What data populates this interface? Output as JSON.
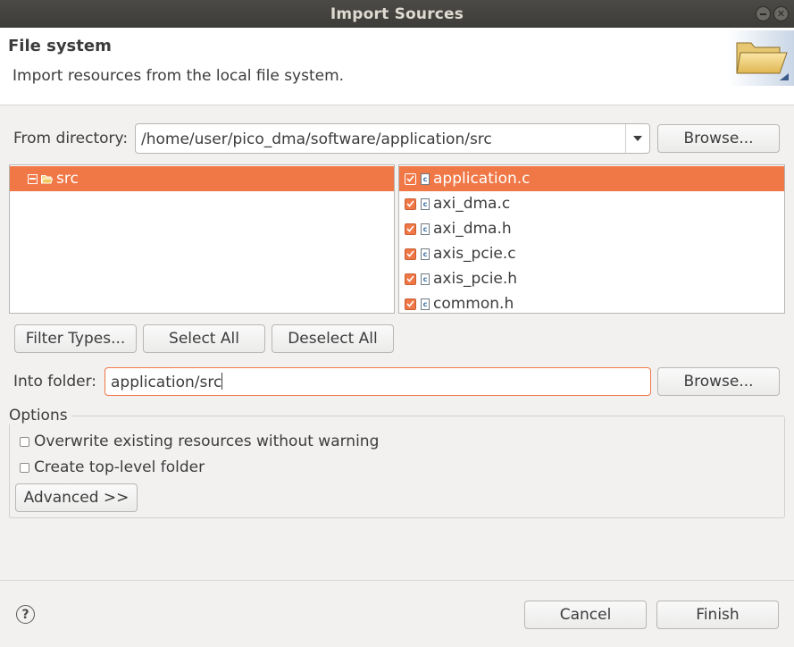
{
  "window": {
    "title": "Import Sources"
  },
  "header": {
    "title": "File system",
    "description": "Import resources from the local file system.",
    "icon": "folder-icon"
  },
  "from_directory": {
    "label": "From directory:",
    "value": "/home/user/pico_dma/software/application/src",
    "browse_label": "Browse..."
  },
  "folder_tree": {
    "items": [
      {
        "label": "src",
        "selected": true,
        "icon": "folder-open-icon"
      }
    ]
  },
  "file_list": {
    "items": [
      {
        "label": "application.c",
        "checked": true,
        "selected": true
      },
      {
        "label": "axi_dma.c",
        "checked": true,
        "selected": false
      },
      {
        "label": "axi_dma.h",
        "checked": true,
        "selected": false
      },
      {
        "label": "axis_pcie.c",
        "checked": true,
        "selected": false
      },
      {
        "label": "axis_pcie.h",
        "checked": true,
        "selected": false
      },
      {
        "label": "common.h",
        "checked": true,
        "selected": false
      }
    ]
  },
  "selection_buttons": {
    "filter_types": "Filter Types...",
    "select_all": "Select All",
    "deselect_all": "Deselect All"
  },
  "into_folder": {
    "label": "Into folder:",
    "value": "application/src",
    "browse_label": "Browse..."
  },
  "options": {
    "legend": "Options",
    "overwrite_label": "Overwrite existing resources without warning",
    "overwrite_checked": false,
    "top_level_label": "Create top-level folder",
    "top_level_checked": false,
    "advanced_label": "Advanced >>"
  },
  "footer": {
    "help": "?",
    "cancel_label": "Cancel",
    "finish_label": "Finish"
  },
  "colors": {
    "accent": "#f07746",
    "titlebar": "#3d3c38",
    "background": "#f2f1f0"
  }
}
